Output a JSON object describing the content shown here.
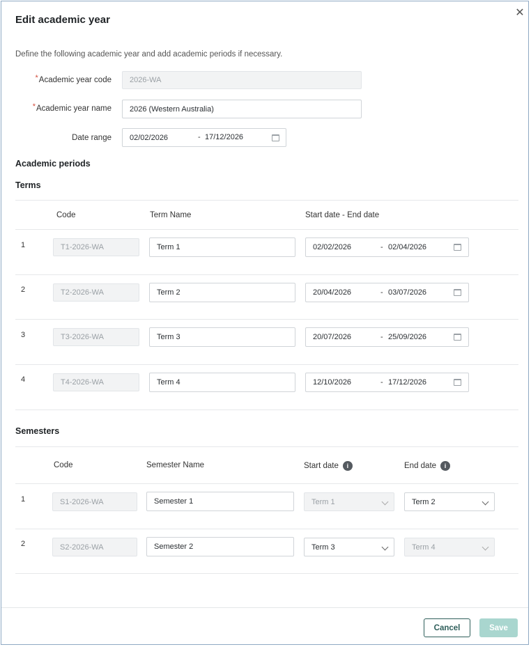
{
  "dialog": {
    "title": "Edit academic year",
    "close_icon": "close-icon",
    "description": "Define the following academic year and add academic periods if necessary."
  },
  "form": {
    "code_label": "Academic year code",
    "code_value": "2026-WA",
    "name_label": "Academic year name",
    "name_value": "2026 (Western Australia)",
    "date_range_label": "Date range",
    "date_start": "02/02/2026",
    "date_end": "17/12/2026",
    "required_mark": "*"
  },
  "periods_heading": "Academic periods",
  "terms": {
    "heading": "Terms",
    "columns": {
      "code": "Code",
      "name": "Term Name",
      "dates": "Start date - End date"
    },
    "rows": [
      {
        "num": "1",
        "code": "T1-2026-WA",
        "name": "Term 1",
        "start": "02/02/2026",
        "end": "02/04/2026"
      },
      {
        "num": "2",
        "code": "T2-2026-WA",
        "name": "Term 2",
        "start": "20/04/2026",
        "end": "03/07/2026"
      },
      {
        "num": "3",
        "code": "T3-2026-WA",
        "name": "Term 3",
        "start": "20/07/2026",
        "end": "25/09/2026"
      },
      {
        "num": "4",
        "code": "T4-2026-WA",
        "name": "Term 4",
        "start": "12/10/2026",
        "end": "17/12/2026"
      }
    ]
  },
  "semesters": {
    "heading": "Semesters",
    "columns": {
      "code": "Code",
      "name": "Semester Name",
      "start": "Start date",
      "end": "End date"
    },
    "rows": [
      {
        "num": "1",
        "code": "S1-2026-WA",
        "name": "Semester 1",
        "start": "Term 1",
        "start_disabled": true,
        "end": "Term 2",
        "end_disabled": false
      },
      {
        "num": "2",
        "code": "S2-2026-WA",
        "name": "Semester 2",
        "start": "Term 3",
        "start_disabled": false,
        "end": "Term 4",
        "end_disabled": true
      }
    ]
  },
  "footer": {
    "cancel": "Cancel",
    "save": "Save"
  },
  "colors": {
    "accent": "#2e5e5a",
    "save_disabled": "#a9d6cf",
    "required": "#d24b3b",
    "border": "#8fa9c4"
  }
}
